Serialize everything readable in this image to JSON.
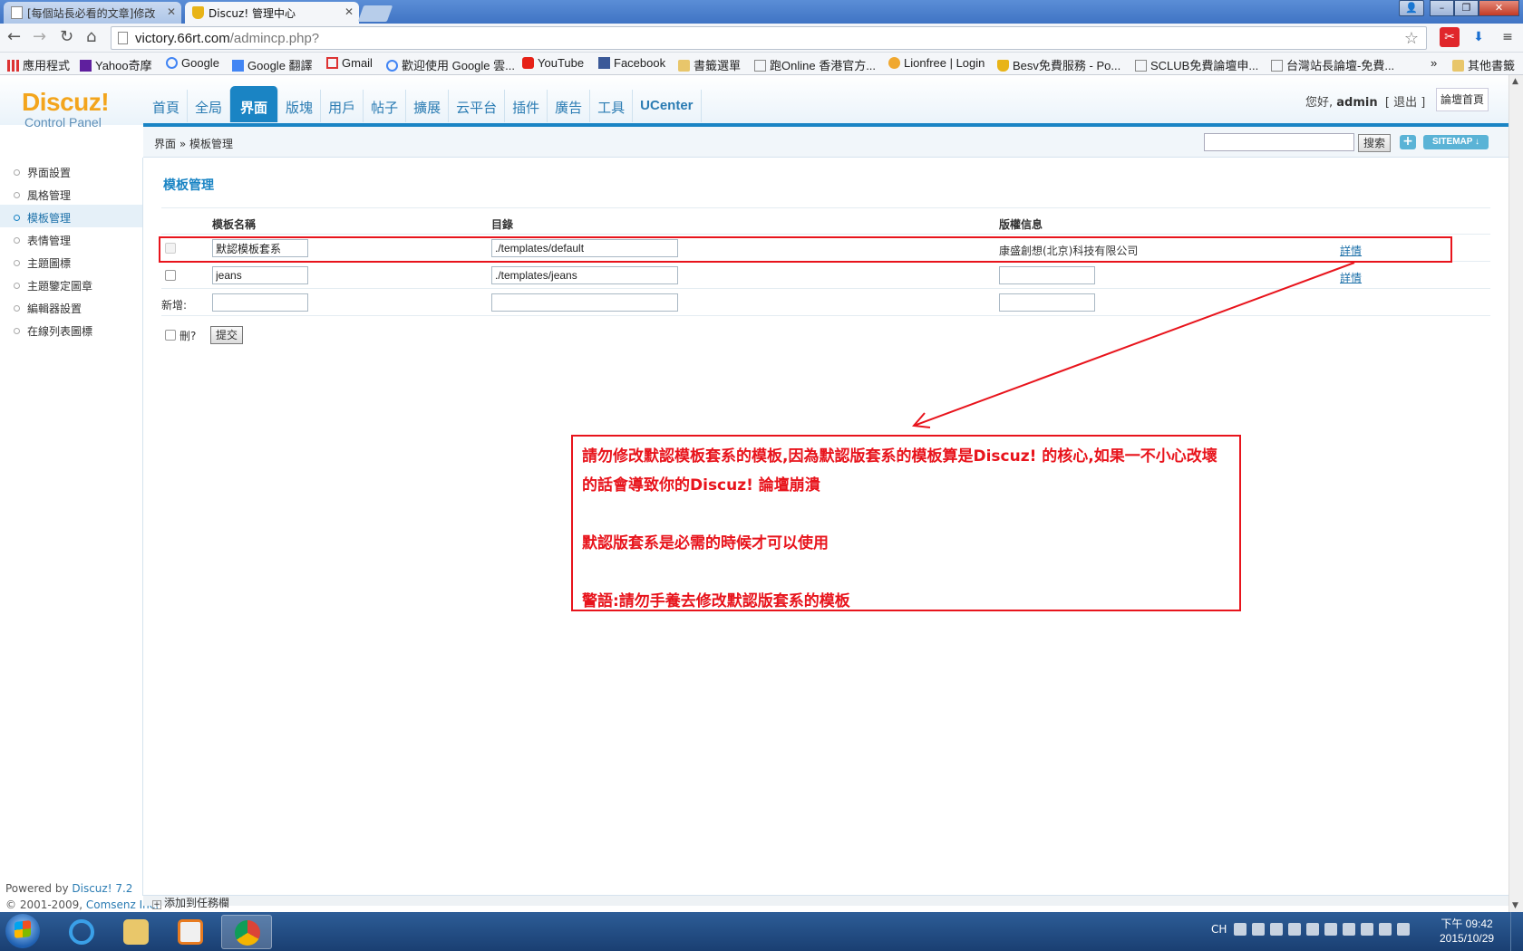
{
  "browser": {
    "tabs": [
      {
        "title": "[每個站長必看的文章]修改",
        "active": false
      },
      {
        "title": "Discuz! 管理中心",
        "active": true
      }
    ],
    "url_host": "victory.66rt.com",
    "url_path": "/admincp.php?",
    "bookmarks": [
      {
        "label": "應用程式",
        "icon": "apps-grid-icon"
      },
      {
        "label": "Yahoo奇摩",
        "icon": "yahoo-icon"
      },
      {
        "label": "Google",
        "icon": "google-icon"
      },
      {
        "label": "Google 翻譯",
        "icon": "translate-icon"
      },
      {
        "label": "Gmail",
        "icon": "gmail-icon"
      },
      {
        "label": "歡迎使用 Google 雲...",
        "icon": "google-icon"
      },
      {
        "label": "YouTube",
        "icon": "youtube-icon"
      },
      {
        "label": "Facebook",
        "icon": "facebook-icon"
      },
      {
        "label": "書籤選單",
        "icon": "folder-icon"
      },
      {
        "label": "跑Online 香港官方...",
        "icon": "page-icon"
      },
      {
        "label": "Lionfree | Login",
        "icon": "lionfree-icon"
      },
      {
        "label": "Besv免費服務 - Po...",
        "icon": "trophy-icon"
      },
      {
        "label": "SCLUB免費論壇申...",
        "icon": "page-icon"
      },
      {
        "label": "台灣站長論壇-免費...",
        "icon": "page-icon"
      }
    ],
    "more": "»",
    "other_bookmarks": "其他書籤"
  },
  "header": {
    "logo_main": "Discuz!",
    "logo_sub": "Control Panel",
    "nav": [
      "首頁",
      "全局",
      "界面",
      "版塊",
      "用戶",
      "帖子",
      "擴展",
      "云平台",
      "插件",
      "廣告",
      "工具",
      "UCenter"
    ],
    "active_nav": "界面",
    "greeting": "您好,",
    "username": "admin",
    "logout": "[ 退出 ]",
    "forum_home": "論壇首頁"
  },
  "crumb": {
    "parent": "界面",
    "sep": "»",
    "current": "模板管理",
    "search_button": "搜索",
    "plus": "+",
    "sitemap": "SITEMAP ↓"
  },
  "sidebar": {
    "items": [
      "界面設置",
      "風格管理",
      "模板管理",
      "表情管理",
      "主題圖標",
      "主題鑒定圖章",
      "編輯器設置",
      "在線列表圖標"
    ],
    "active": "模板管理",
    "powered_prefix": "Powered by ",
    "powered_link": "Discuz! 7.2",
    "copyright_prefix": "© 2001-2009, ",
    "copyright_link": "Comsenz Inc."
  },
  "main": {
    "title": "模板管理",
    "columns": [
      "模板名稱",
      "目錄",
      "版權信息"
    ],
    "rows": [
      {
        "name": "默認模板套系",
        "dir": "./templates/default",
        "copyright": "康盛創想(北京)科技有限公司",
        "link": "詳情"
      },
      {
        "name": "jeans",
        "dir": "./templates/jeans",
        "copyright": "",
        "link": "詳情"
      }
    ],
    "new_label": "新增:",
    "delete_label": "刪?",
    "submit": "提交"
  },
  "annotation": {
    "color": "#e8141c",
    "line1": "請勿修改默認模板套系的模板,因為默認版套系的模板算是Discuz! 的核心,如果一不小心改壞的話會導致你的Discuz! 論壇崩潰",
    "line2": "默認版套系是必需的時候才可以使用",
    "line3": "警語:請勿手養去修改默認版套系的模板"
  },
  "bottom": {
    "add_task": "添加到任務欄"
  },
  "taskbar": {
    "tray_lang": "CH",
    "time": "下午 09:42",
    "date": "2015/10/29"
  },
  "colors": {
    "accent": "#1a84c4",
    "logo": "#f3a51d",
    "link": "#2b7cb3",
    "alert": "#e8141c"
  }
}
